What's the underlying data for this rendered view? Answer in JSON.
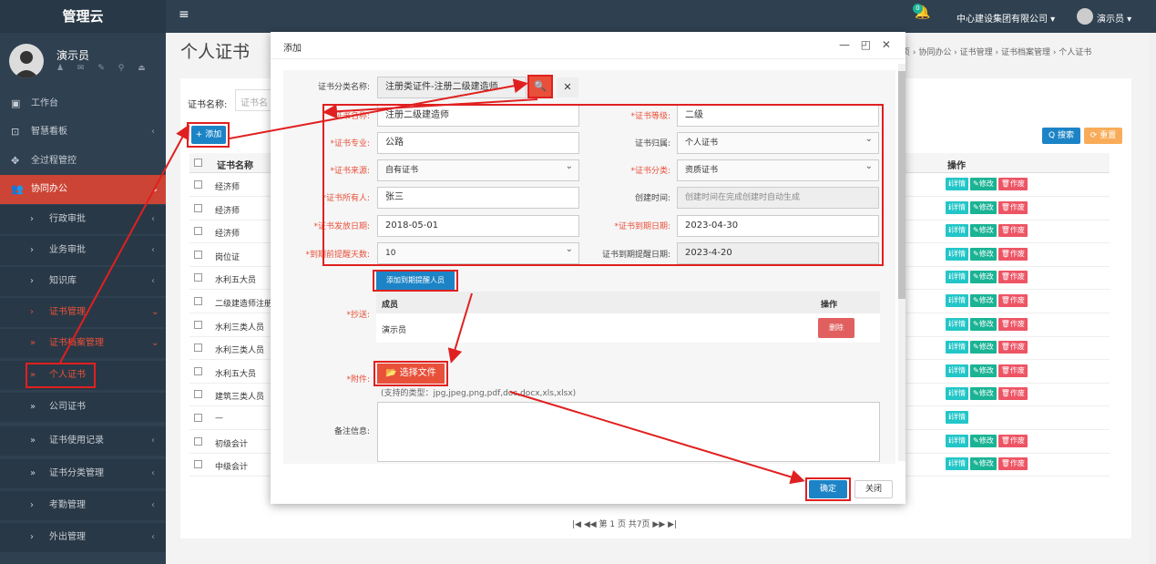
{
  "app": {
    "logo": "管理云",
    "company": "中心建设集团有限公司 ▾",
    "user": "演示员 ▾",
    "notify_count": "0"
  },
  "profile": {
    "name": "演示员"
  },
  "sidebar": {
    "items": [
      {
        "label": "工作台"
      },
      {
        "label": "智慧看板"
      },
      {
        "label": "全过程管控"
      },
      {
        "label": "协同办公"
      },
      {
        "label": "行政审批"
      },
      {
        "label": "业务审批"
      },
      {
        "label": "知识库"
      },
      {
        "label": "证书管理"
      },
      {
        "label": "证书档案管理"
      },
      {
        "label": "个人证书"
      },
      {
        "label": "公司证书"
      },
      {
        "label": "证书使用记录"
      },
      {
        "label": "证书分类管理"
      },
      {
        "label": "考勤管理"
      },
      {
        "label": "外出管理"
      }
    ]
  },
  "page": {
    "title": "个人证书",
    "breadcrumb": "页 › 协同办公 › 证书管理 › 证书档案管理 › 个人证书",
    "search_label": "证书名称:",
    "search_placeholder": "证书名",
    "add_label": "+ 添加",
    "search_btn": "Q 搜索",
    "reset_btn": "⟳ 重置",
    "col_name": "证书名称",
    "col_ops": "操作",
    "rows": [
      "经济师",
      "经济师",
      "经济师",
      "岗位证",
      "水利五大员",
      "二级建造师注册",
      "水利三类人员",
      "水利三类人员",
      "水利五大员",
      "建筑三类人员",
      "—",
      "初级会计",
      "中级会计"
    ],
    "btn_detail": "ℹ详情",
    "btn_edit": "✎修改",
    "btn_void": "🗑作废",
    "pager": "|◀  ◀◀  第 1  页  共7页  ▶▶  ▶|"
  },
  "modal": {
    "title": "添加",
    "controls": "— ◰ ✕",
    "category_label": "证书分类名称:",
    "category_value": "注册类证件-注册二级建造师",
    "name_label": "*证书名称:",
    "name_value": "注册二级建造师",
    "level_label": "*证书等级:",
    "level_value": "二级",
    "major_label": "*证书专业:",
    "major_value": "公路",
    "owner_type_label": "证书归属:",
    "owner_type_value": "个人证书",
    "source_label": "*证书来源:",
    "source_value": "自有证书",
    "class_label": "*证书分类:",
    "class_value": "资质证书",
    "holder_label": "*证书所有人:",
    "holder_value": "张三",
    "created_label": "创建时间:",
    "created_value": "创建时间在完成创建时自动生成",
    "issue_label": "*证书发放日期:",
    "issue_value": "2018-05-01",
    "expire_label": "*证书到期日期:",
    "expire_value": "2023-04-30",
    "remind_days_label": "*到期前提醒天数:",
    "remind_days_value": "10",
    "remind_date_label": "证书到期提醒日期:",
    "remind_date_value": "2023-4-20",
    "add_reminder": "添加到期提醒人员",
    "cc_label": "*抄送:",
    "cc_col_member": "成员",
    "cc_col_ops": "操作",
    "cc_member": "演示员",
    "cc_delete": "删除",
    "attach_label": "*附件:",
    "attach_btn": "📂 选择文件",
    "attach_types": "(支持的类型：jpg,jpeg,png,pdf,doc,docx,xls,xlsx)",
    "remark_label": "备注信息:",
    "ok": "确定",
    "close": "关闭"
  },
  "colors": {
    "sidebar": "#2f4050",
    "accent_red": "#e8503a",
    "primary": "#1c84c6"
  }
}
